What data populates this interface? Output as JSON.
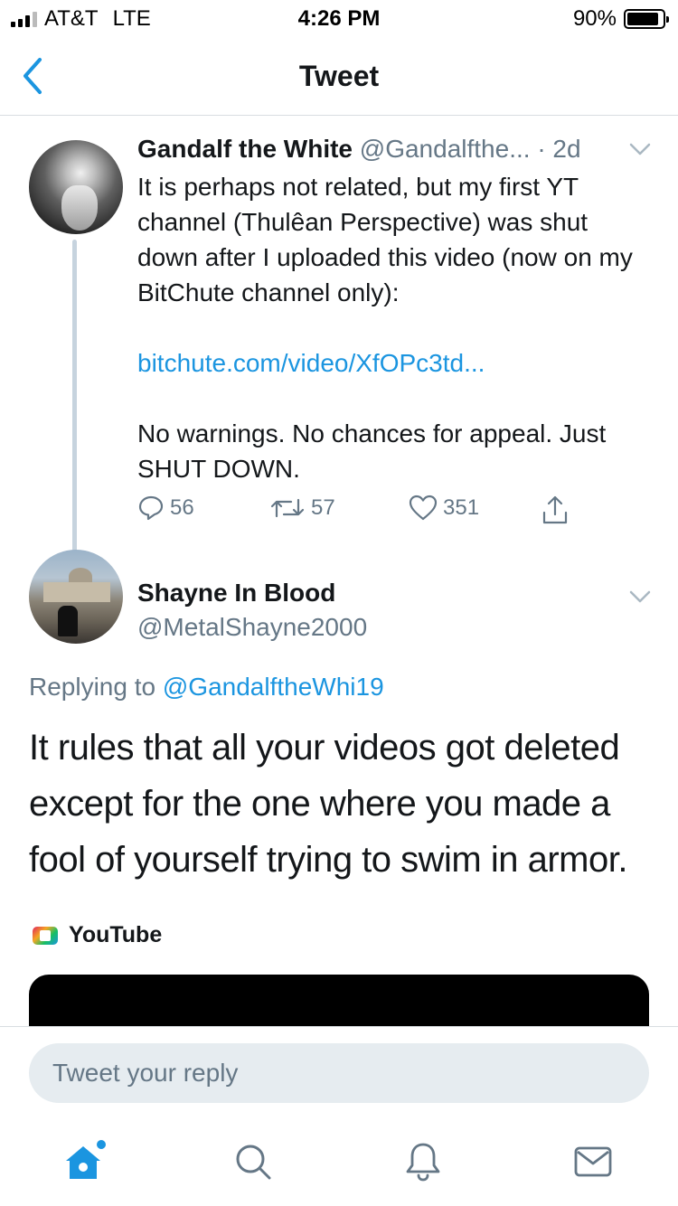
{
  "status_bar": {
    "carrier": "AT&T",
    "network": "LTE",
    "time": "4:26 PM",
    "battery": "90%",
    "battery_level": 0.9
  },
  "nav": {
    "title": "Tweet",
    "back_icon": "chevron-left-icon"
  },
  "parent_tweet": {
    "author_name": "Gandalf the White",
    "author_handle": "@Gandalfthe...",
    "age": "· 2d",
    "text_line1": "It is perhaps not related, but my first YT channel (Thulêan Perspective) was shut down after I uploaded this video (now on my BitChute channel only):",
    "link": "bitchute.com/video/XfOPc3td...",
    "text_line2": "No warnings. No chances for appeal. Just SHUT DOWN.",
    "replies": "56",
    "retweets": "57",
    "likes": "351"
  },
  "reply_tweet": {
    "author_name": "Shayne In Blood",
    "author_handle": "@MetalShayne2000",
    "replying_prefix": "Replying to",
    "replying_to": "@GandalftheWhi19",
    "text": "It rules that all your videos got deleted except for the one where you made a fool of yourself trying to swim in armor.",
    "embed_source": "YouTube"
  },
  "reply_bar": {
    "placeholder": "Tweet your reply"
  },
  "tab_bar": {
    "items": [
      "home-icon",
      "search-icon",
      "notifications-icon",
      "messages-icon"
    ]
  },
  "colors": {
    "accent": "#1b95e0",
    "secondary_text": "#657786",
    "primary_text": "#14171a"
  }
}
